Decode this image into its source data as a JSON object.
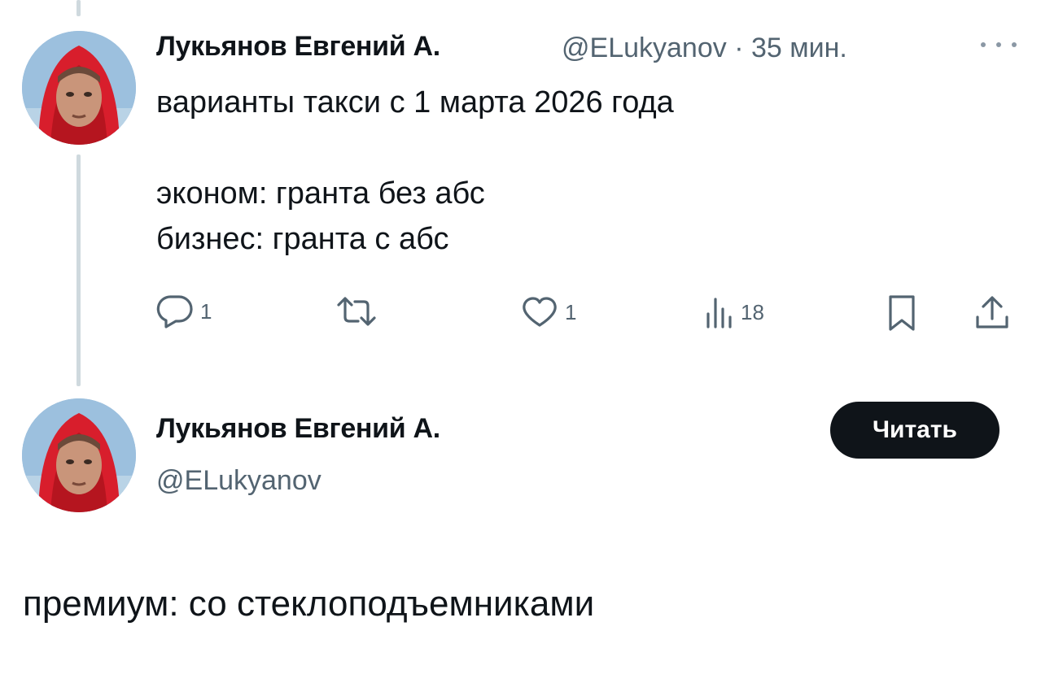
{
  "tweet": {
    "author_name": "Лукьянов Евгений А.",
    "handle": "@ELukyanov",
    "separator": "·",
    "time": "35 мин.",
    "text": "варианты такси с 1 марта 2026 года\n\nэконом: гранта без абс\nбизнес: гранта с абс",
    "actions": {
      "replies": "1",
      "retweets": "",
      "likes": "1",
      "views": "18"
    },
    "icons": {
      "more": "more-dots-icon",
      "reply": "reply-bubble-icon",
      "retweet": "retweet-icon",
      "like": "heart-icon",
      "views": "views-bars-icon",
      "bookmark": "bookmark-icon",
      "share": "share-icon"
    }
  },
  "profile_card": {
    "author_name": "Лукьянов Евгений А.",
    "handle": "@ELukyanov",
    "follow_label": "Читать"
  },
  "reply": {
    "text": "премиум: со стеклоподъемниками"
  },
  "colors": {
    "text": "#0f1419",
    "secondary": "#536471",
    "thread_line": "#cfd9de",
    "button_bg": "#0f1419",
    "button_text": "#ffffff"
  }
}
